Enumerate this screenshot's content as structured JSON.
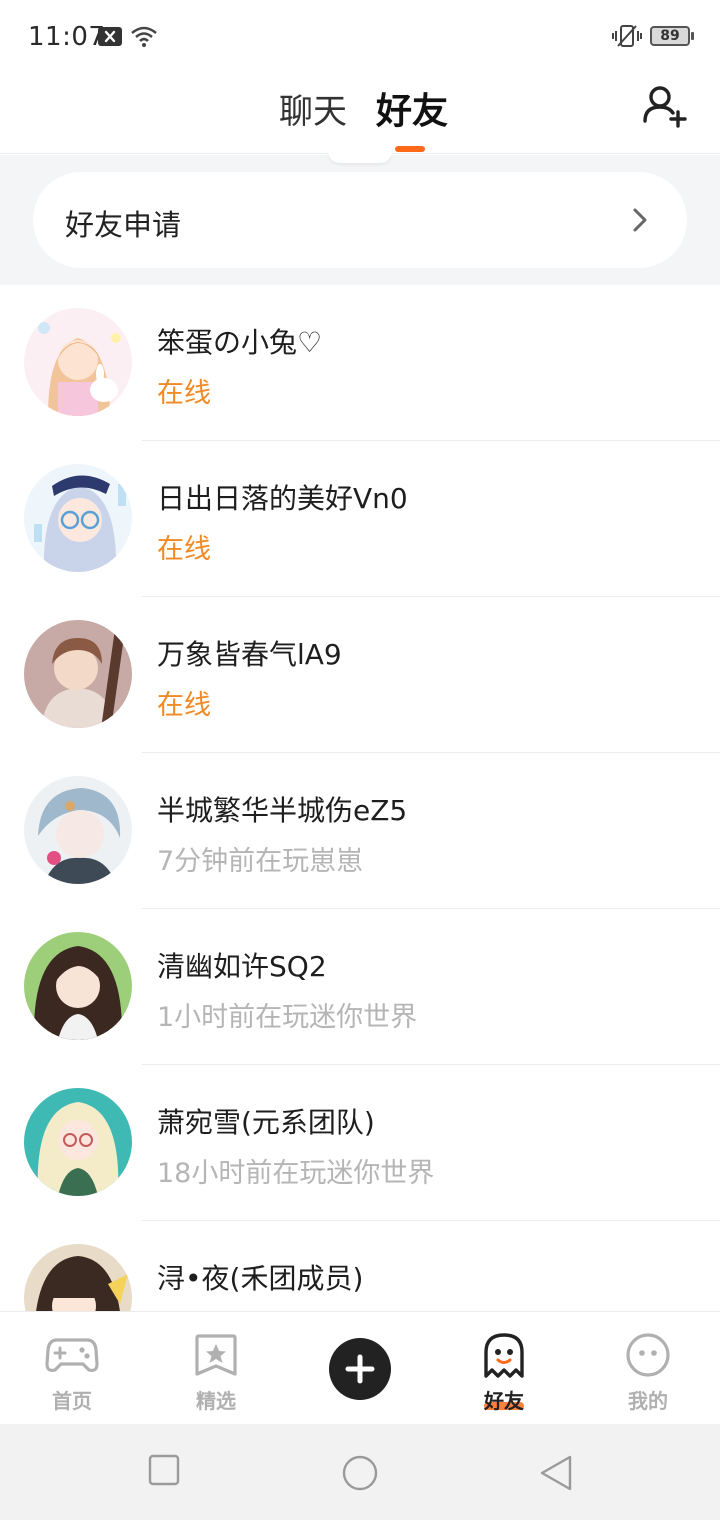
{
  "status_bar": {
    "time": "11:07",
    "battery": "89"
  },
  "header": {
    "tabs": [
      {
        "label": "聊天",
        "active": false
      },
      {
        "label": "好友",
        "active": true
      }
    ],
    "accent_color": "#ff6a1a"
  },
  "friend_request": {
    "label": "好友申请"
  },
  "friends": [
    {
      "name": "笨蛋の小兔♡",
      "status": "在线",
      "online": true
    },
    {
      "name": "日出日落的美好Vn0",
      "status": "在线",
      "online": true
    },
    {
      "name": "万象皆春气lA9",
      "status": "在线",
      "online": true
    },
    {
      "name": "半城繁华半城伤eZ5",
      "status": "7分钟前在玩崽崽",
      "online": false
    },
    {
      "name": "清幽如许SQ2",
      "status": "1小时前在玩迷你世界",
      "online": false
    },
    {
      "name": "萧宛雪(元系团队)",
      "status": "18小时前在玩迷你世界",
      "online": false
    },
    {
      "name": "浔•夜(禾团成员)",
      "status": "",
      "online": false
    }
  ],
  "bottom_nav": {
    "items": [
      {
        "label": "首页",
        "icon": "gamepad-icon",
        "active": false
      },
      {
        "label": "精选",
        "icon": "star-bookmark-icon",
        "active": false
      },
      {
        "label": "",
        "icon": "plus-icon",
        "active": false
      },
      {
        "label": "好友",
        "icon": "ghost-icon",
        "active": true
      },
      {
        "label": "我的",
        "icon": "face-icon",
        "active": false
      }
    ]
  },
  "colors": {
    "online": "#f08a24",
    "offline": "#b5b5b5"
  }
}
